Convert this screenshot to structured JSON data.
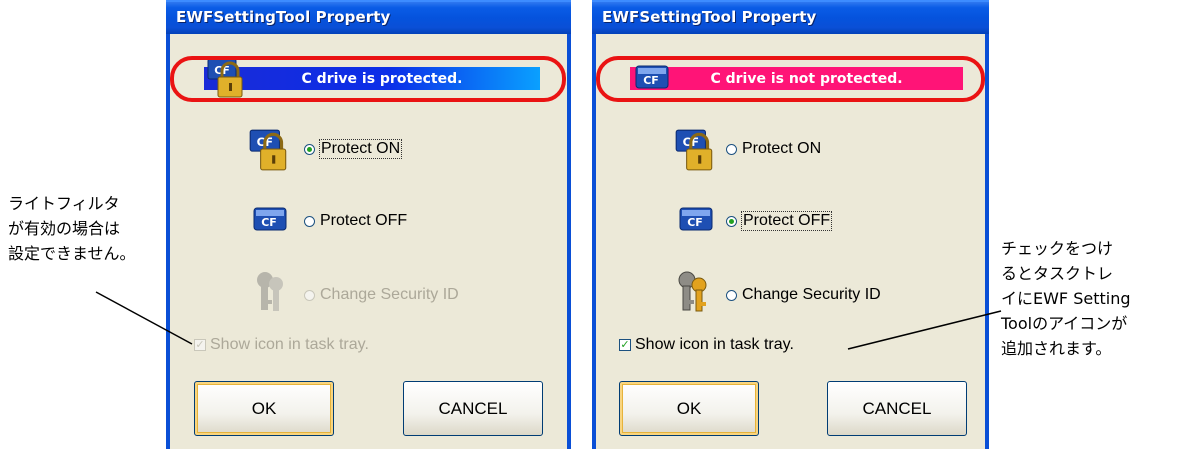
{
  "left_dialog": {
    "title": "EWFSettingTool Property",
    "status_text": "C drive is protected.",
    "status_state": "protected",
    "protect_on_label": "Protect ON",
    "protect_on_selected": true,
    "protect_off_label": "Protect OFF",
    "protect_off_selected": false,
    "change_security_label": "Change Security ID",
    "change_security_enabled": false,
    "show_icon_label": "Show icon in task tray.",
    "show_icon_checked": true,
    "show_icon_enabled": false,
    "ok_label": "OK",
    "cancel_label": "CANCEL"
  },
  "right_dialog": {
    "title": "EWFSettingTool Property",
    "status_text": "C drive is not protected.",
    "status_state": "not-protected",
    "protect_on_label": "Protect ON",
    "protect_on_selected": false,
    "protect_off_label": "Protect OFF",
    "protect_off_selected": true,
    "change_security_label": "Change Security ID",
    "change_security_enabled": true,
    "show_icon_label": "Show icon in task tray.",
    "show_icon_checked": true,
    "show_icon_enabled": true,
    "ok_label": "OK",
    "cancel_label": "CANCEL"
  },
  "annotations": {
    "left_note": "ライトフィルタ\nが有効の場合は\n設定できません。",
    "right_note": "チェックをつけ\nるとタスクトレ\nイにEWF Setting\nToolのアイコンが\n追加されます。"
  },
  "colors": {
    "titlebar": "#0553dd",
    "protected_bar": "#0b2ee8",
    "not_protected_bar": "#ff1477",
    "highlight_ring": "#ea1313",
    "dialog_bg": "#ece9d8"
  },
  "icons": {
    "protected": "cf-card-padlock-icon",
    "not_protected": "cf-card-icon",
    "security_id": "keys-icon"
  }
}
